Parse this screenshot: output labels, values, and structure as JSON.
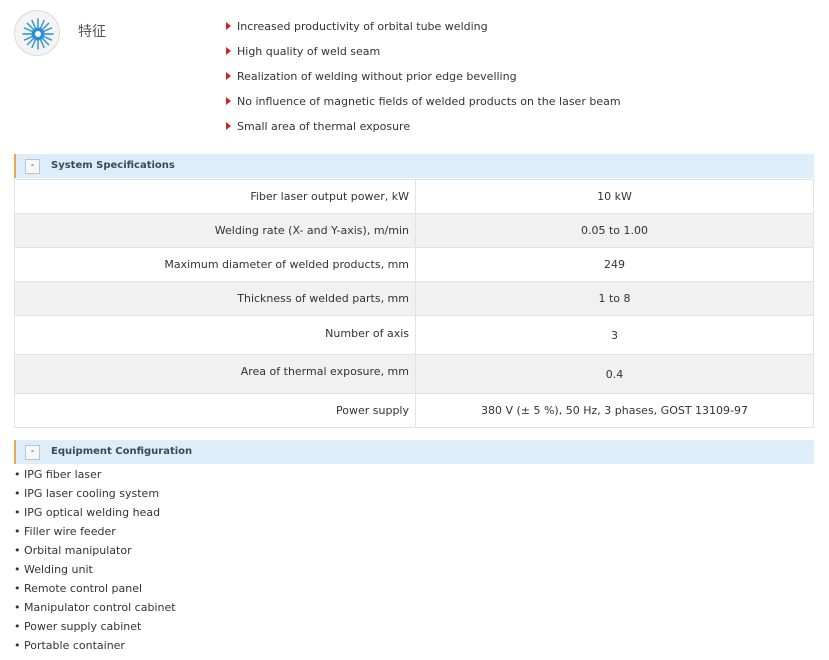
{
  "features": {
    "title": "特征",
    "items": [
      "Increased productivity of orbital tube welding",
      "High quality of weld seam",
      "Realization of welding without prior edge bevelling",
      "No influence of magnetic fields of welded products on the laser beam",
      "Small area of thermal exposure"
    ]
  },
  "system_specs": {
    "collapse_label": "-",
    "title": "System Specifications",
    "rows": [
      {
        "label": "Fiber laser output power, kW",
        "value": "10 kW"
      },
      {
        "label": "Welding rate (X- and Y-axis), m/min",
        "value": "0.05 to 1.00"
      },
      {
        "label": "Maximum diameter of welded products, mm",
        "value": "249"
      },
      {
        "label": "Thickness of welded parts, mm",
        "value": "1 to 8"
      },
      {
        "label": "Number of axis",
        "value": "3"
      },
      {
        "label": "Area of thermal exposure, mm",
        "value": "0.4"
      },
      {
        "label": "Power supply",
        "value": "380 V (± 5 %), 50 Hz, 3 phases, GOST 13109-97"
      }
    ]
  },
  "equipment": {
    "collapse_label": "-",
    "title": "Equipment Configuration",
    "items": [
      "• IPG fiber laser",
      "• IPG laser cooling system",
      "• IPG optical welding head",
      "• Filler wire feeder",
      "• Orbital manipulator",
      "• Welding unit",
      "• Remote control panel",
      "• Manipulator control cabinet",
      "• Power supply cabinet",
      "• Portable container"
    ]
  },
  "colors": {
    "accent_orange": "#f0a64a",
    "header_blue": "#ddeefa",
    "arrow_red": "#d21f1f",
    "icon_blue": "#2a8fd4"
  },
  "icons": {
    "feature_logo": "laser-burst-icon",
    "feature_bullet": "red-arrow-icon"
  }
}
